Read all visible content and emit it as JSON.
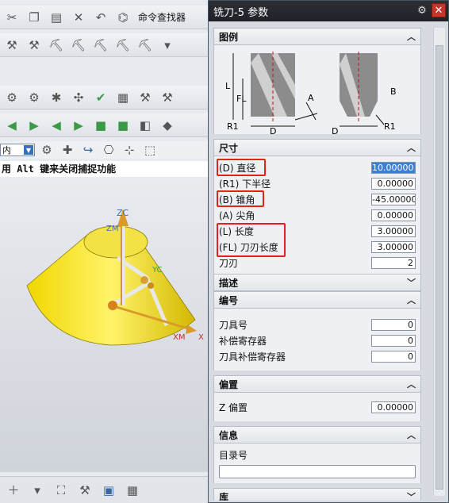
{
  "app": {
    "toolbar_command_find": "命令查找器",
    "selection_filter": "内",
    "hint": "用 Alt 键来关闭捕捉功能",
    "axis_labels": {
      "zc": "ZC",
      "zm": "ZM",
      "yc": "YC",
      "xm": "XM",
      "x": "X"
    }
  },
  "dialog": {
    "title": "铣刀-5 参数",
    "sections": {
      "legend": "图例",
      "dimensions": "尺寸",
      "description": "描述",
      "numbering": "编号",
      "offset": "偏置",
      "info": "信息",
      "library": "库"
    },
    "legend_labels": {
      "L": "L",
      "FL": "FL",
      "R1": "R1",
      "D": "D",
      "A": "A",
      "B": "B"
    },
    "dimensions": [
      {
        "label": "(D) 直径",
        "value": "10.00000"
      },
      {
        "label": "(R1) 下半径",
        "value": "0.00000"
      },
      {
        "label": "(B) 锥角",
        "value": "-45.00000"
      },
      {
        "label": "(A) 尖角",
        "value": "0.00000"
      },
      {
        "label": "(L) 长度",
        "value": "3.00000"
      },
      {
        "label": "(FL) 刀刃长度",
        "value": "3.00000"
      },
      {
        "label": "刀刃",
        "value": "2"
      }
    ],
    "numbering": [
      {
        "label": "刀具号",
        "value": "0"
      },
      {
        "label": "补偿寄存器",
        "value": "0"
      },
      {
        "label": "刀具补偿寄存器",
        "value": "0"
      }
    ],
    "offset": [
      {
        "label": "Z 偏置",
        "value": "0.00000"
      }
    ],
    "info": {
      "catalog_label": "目录号",
      "catalog_value": ""
    }
  }
}
